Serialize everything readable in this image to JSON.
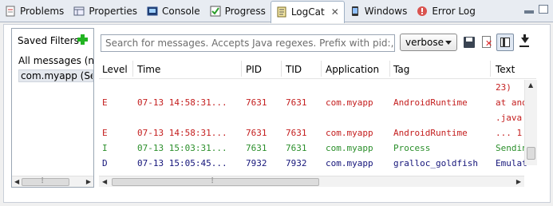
{
  "tabs": [
    {
      "label": "Problems",
      "icon": "problems-icon"
    },
    {
      "label": "Properties",
      "icon": "properties-icon"
    },
    {
      "label": "Console",
      "icon": "console-icon"
    },
    {
      "label": "Progress",
      "icon": "progress-icon"
    },
    {
      "label": "LogCat",
      "icon": "logcat-icon",
      "active": true
    },
    {
      "label": "Windows",
      "icon": "windows-icon"
    },
    {
      "label": "Error Log",
      "icon": "error-log-icon"
    }
  ],
  "filters": {
    "title": "Saved Filters",
    "items": [
      "All messages (no filters)",
      "com.myapp (Session Filter)"
    ]
  },
  "search": {
    "placeholder": "Search for messages. Accepts Java regexes. Prefix with pid:, app:, tag: or text: to limit scope."
  },
  "level_select": {
    "value": "verbose"
  },
  "table": {
    "headers": [
      "Level",
      "Time",
      "PID",
      "TID",
      "Application",
      "Tag",
      "Text"
    ],
    "rows": [
      {
        "level": "",
        "time": "",
        "pid": "",
        "tid": "",
        "app": "",
        "tag": "",
        "text": "23)"
      },
      {
        "level": "E",
        "time": "07-13 14:58:31...",
        "pid": "7631",
        "tid": "7631",
        "app": "com.myapp",
        "tag": "AndroidRuntime",
        "text": "at android"
      },
      {
        "level": "",
        "time": "",
        "pid": "",
        "tid": "",
        "app": "",
        "tag": "",
        "text": ".java"
      },
      {
        "level": "E",
        "time": "07-13 14:58:31...",
        "pid": "7631",
        "tid": "7631",
        "app": "com.myapp",
        "tag": "AndroidRuntime",
        "text": "... 1"
      },
      {
        "level": "I",
        "time": "07-13 15:03:31...",
        "pid": "7631",
        "tid": "7631",
        "app": "com.myapp",
        "tag": "Process",
        "text": "Sending"
      },
      {
        "level": "D",
        "time": "07-13 15:05:45...",
        "pid": "7932",
        "tid": "7932",
        "app": "com.myapp",
        "tag": "gralloc_goldfish",
        "text": "Emulator"
      }
    ]
  },
  "colors": {
    "error": "#c41e1e",
    "info": "#2b8f2b",
    "debug": "#15157a",
    "add": "#22b422"
  }
}
